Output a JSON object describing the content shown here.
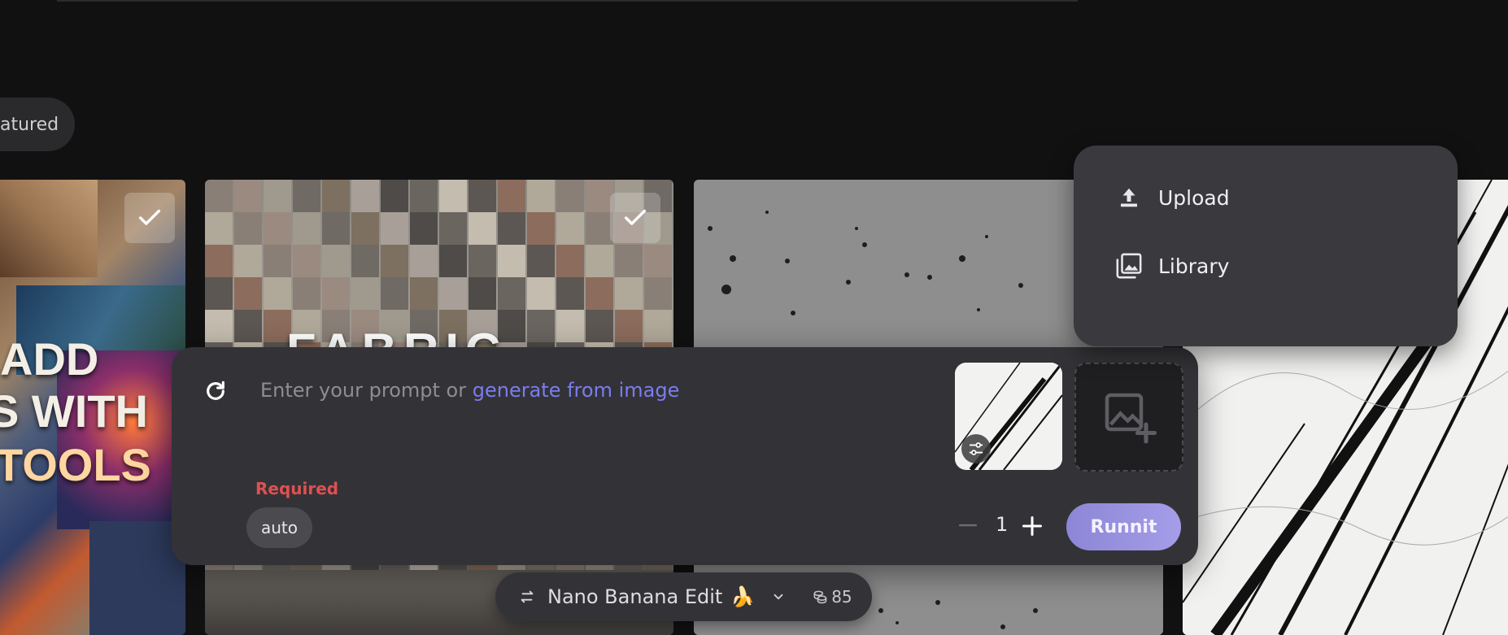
{
  "filters": {
    "featured_label": "atured"
  },
  "tile_1": {
    "overlay_lines": [
      "ADD",
      "S WITH",
      "TOOLS"
    ]
  },
  "tile_2": {
    "overlay_text": "FABRIC"
  },
  "prompt": {
    "placeholder_text": "Enter your prompt or",
    "link_text": "generate from image",
    "required_label": "Required",
    "aspect_chip": "auto",
    "quantity": "1",
    "run_label": "Runnit"
  },
  "menu": {
    "items": [
      {
        "label": "Upload",
        "icon": "upload-icon"
      },
      {
        "label": "Library",
        "icon": "library-icon"
      }
    ]
  },
  "model": {
    "name": "Nano Banana Edit",
    "emoji": "🍌",
    "credits": "85"
  },
  "colors": {
    "background": "#111112",
    "panel": "#333337",
    "accent_link": "#7b7cf0",
    "required": "#e05050",
    "run_button": "#a59de8"
  }
}
